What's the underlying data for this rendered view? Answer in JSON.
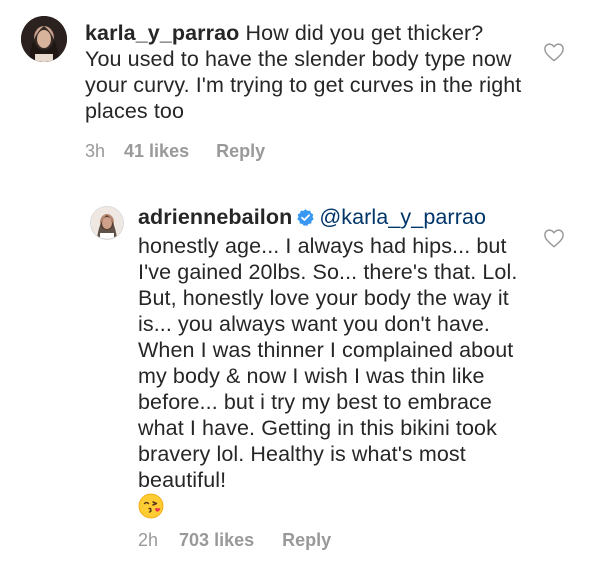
{
  "comments": [
    {
      "username": "karla_y_parrao",
      "text": "How did you get thicker? You used to have the slender body type now your curvy. I'm trying to get curves in the right places too",
      "time": "3h",
      "likes": "41 likes",
      "reply_label": "Reply",
      "avatar_icon": "profile-photo-karla",
      "like_icon": "heart-outline-icon"
    },
    {
      "username": "adriennebailon",
      "verified_icon": "verified-badge-icon",
      "mention": "@karla_y_parrao",
      "text": "honestly age... I always had hips... but I've gained 20lbs. So... there's that. Lol. But, honestly love your body the way it is... you always want you don't have. When I was thinner I complained about my body & now I wish I was thin like before... but i try my best to embrace what I have. Getting in this bikini took bravery lol. Healthy is what's most beautiful!",
      "emoji": "face-blowing-a-kiss-emoji",
      "time": "2h",
      "likes": "703 likes",
      "reply_label": "Reply",
      "avatar_icon": "profile-photo-adrienne",
      "like_icon": "heart-outline-icon"
    }
  ],
  "colors": {
    "text": "#262626",
    "meta": "#999999",
    "mention": "#003569",
    "verified": "#3897f0"
  }
}
